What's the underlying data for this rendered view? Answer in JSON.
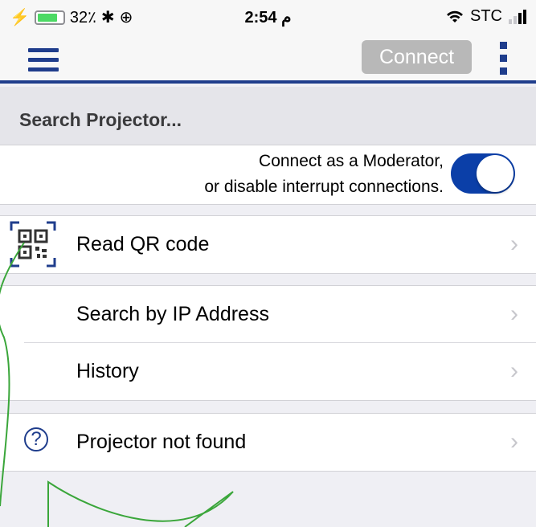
{
  "status_bar": {
    "battery_percent": "32٪",
    "time": "2:54 م",
    "carrier": "STC"
  },
  "toolbar": {
    "connect_label": "Connect"
  },
  "search": {
    "placeholder_text": "Search Projector..."
  },
  "moderator": {
    "line1": "Connect as a Moderator,",
    "line2": "or disable interrupt connections.",
    "toggle_on": true
  },
  "menu": {
    "read_qr": "Read QR code",
    "search_ip": "Search by IP Address",
    "history": "History",
    "not_found": "Projector not found"
  },
  "colors": {
    "accent": "#1f3d8c",
    "toggle": "#0b3fa8",
    "annotation": "#3aa63a"
  },
  "icons": {
    "menu": "hamburger-icon",
    "more": "kebab-icon",
    "qr": "qr-code-icon",
    "help": "question-circle-icon"
  }
}
